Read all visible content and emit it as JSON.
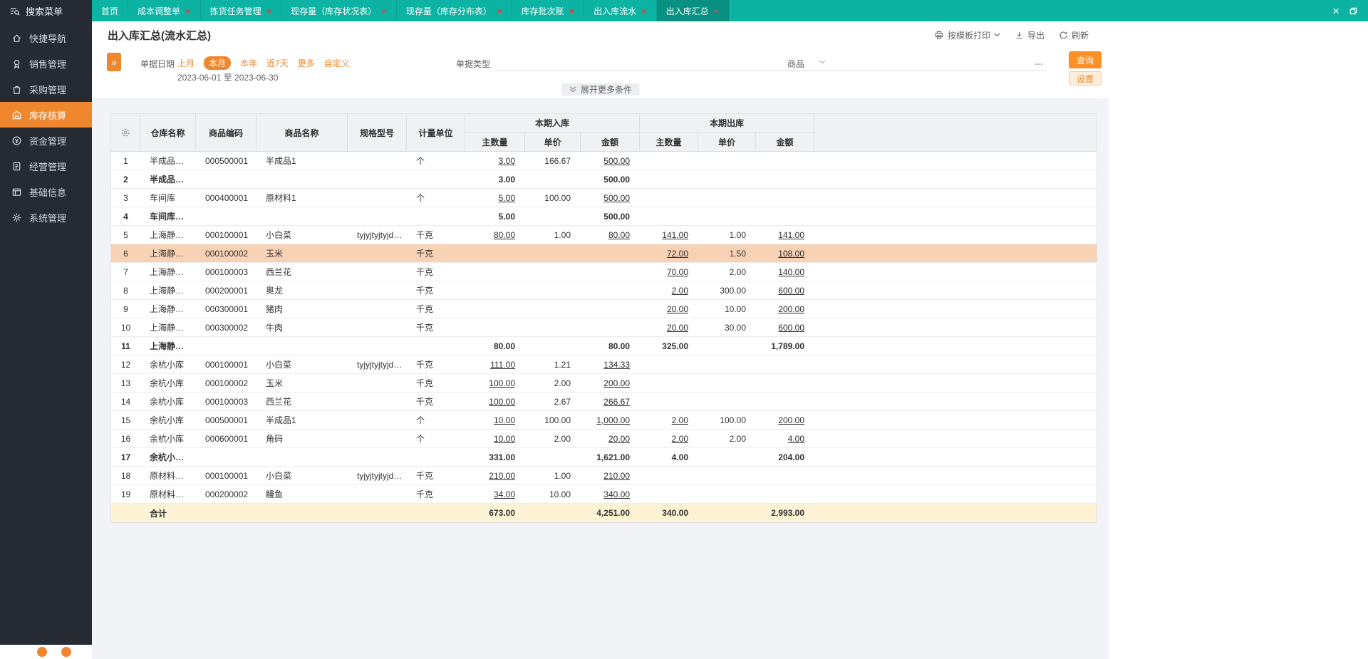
{
  "window": {
    "close_icon_name": "close-icon",
    "restore_icon_name": "restore-icon"
  },
  "sidebar": {
    "search_label": "搜索菜单",
    "search_icon": "search-menu-icon",
    "items": [
      {
        "label": "快捷导航",
        "icon": "nav-icon",
        "active": false
      },
      {
        "label": "销售管理",
        "icon": "sales-icon",
        "active": false
      },
      {
        "label": "采购管理",
        "icon": "purchase-icon",
        "active": false
      },
      {
        "label": "库存核算",
        "icon": "inventory-icon",
        "active": true
      },
      {
        "label": "资金管理",
        "icon": "funds-icon",
        "active": false
      },
      {
        "label": "经营管理",
        "icon": "operation-icon",
        "active": false
      },
      {
        "label": "基础信息",
        "icon": "baseinfo-icon",
        "active": false
      },
      {
        "label": "系统管理",
        "icon": "system-icon",
        "active": false
      }
    ]
  },
  "tabs": [
    {
      "label": "首页",
      "closable": false,
      "active": false
    },
    {
      "label": "成本调整单",
      "closable": true,
      "active": false
    },
    {
      "label": "拣货任务管理",
      "closable": true,
      "active": false
    },
    {
      "label": "现存量（库存状况表）",
      "closable": true,
      "active": false
    },
    {
      "label": "现存量（库存分布表）",
      "closable": true,
      "active": false
    },
    {
      "label": "库存批次账",
      "closable": true,
      "active": false
    },
    {
      "label": "出入库流水",
      "closable": true,
      "active": false
    },
    {
      "label": "出入库汇总",
      "closable": true,
      "active": true
    }
  ],
  "page": {
    "title": "出入库汇总(流水汇总)",
    "print_label": "按模板打印",
    "print_icon": "printer-icon",
    "export_label": "导出",
    "export_icon": "export-icon",
    "refresh_label": "刷新",
    "refresh_icon": "refresh-icon"
  },
  "filters": {
    "expand_collapse_icon": "double-angle-right-icon",
    "date_label": "单据日期",
    "date_options": [
      {
        "label": "上月",
        "selected": false
      },
      {
        "label": "本月",
        "selected": true
      },
      {
        "label": "本年",
        "selected": false
      },
      {
        "label": "近7天",
        "selected": false
      },
      {
        "label": "更多",
        "selected": false
      },
      {
        "label": "自定义",
        "selected": false
      }
    ],
    "date_range": "2023-06-01 至 2023-06-30",
    "doc_type_label": "单据类型",
    "doc_type_value": "",
    "product_label": "商品",
    "product_value": "",
    "product_more": "…",
    "query_button": "查询",
    "settings_button": "设置",
    "expand_more": "展开更多条件"
  },
  "table": {
    "gear_icon": "column-settings-gear-icon",
    "headers": {
      "warehouse": "仓库名称",
      "code": "商品编码",
      "name": "商品名称",
      "spec": "规格型号",
      "unit": "计量单位",
      "in_group": "本期入库",
      "out_group": "本期出库",
      "qty": "主数量",
      "price": "单价",
      "amount": "金额"
    },
    "rows": [
      {
        "idx": "1",
        "warehouse": "半成品仓库",
        "code": "000500001",
        "name": "半成品1",
        "spec": "",
        "unit": "个",
        "in_qty": "3.00",
        "in_price": "166.67",
        "in_amt": "500.00",
        "out_qty": "",
        "out_price": "",
        "out_amt": "",
        "style": "normal"
      },
      {
        "idx": "2",
        "warehouse": "半成品仓库...",
        "code": "",
        "name": "",
        "spec": "",
        "unit": "",
        "in_qty": "3.00",
        "in_price": "",
        "in_amt": "500.00",
        "out_qty": "",
        "out_price": "",
        "out_amt": "",
        "style": "subtotal"
      },
      {
        "idx": "3",
        "warehouse": "车间库",
        "code": "000400001",
        "name": "原材料1",
        "spec": "",
        "unit": "个",
        "in_qty": "5.00",
        "in_price": "100.00",
        "in_amt": "500.00",
        "out_qty": "",
        "out_price": "",
        "out_amt": "",
        "style": "normal"
      },
      {
        "idx": "4",
        "warehouse": "车间库【小...",
        "code": "",
        "name": "",
        "spec": "",
        "unit": "",
        "in_qty": "5.00",
        "in_price": "",
        "in_amt": "500.00",
        "out_qty": "",
        "out_price": "",
        "out_amt": "",
        "style": "subtotal"
      },
      {
        "idx": "5",
        "warehouse": "上海静安仓",
        "code": "000100001",
        "name": "小白菜",
        "spec": "tyjyjtyjtyjdf...",
        "unit": "千克",
        "in_qty": "80.00",
        "in_price": "1.00",
        "in_amt": "80.00",
        "out_qty": "141.00",
        "out_price": "1.00",
        "out_amt": "141.00",
        "style": "normal"
      },
      {
        "idx": "6",
        "warehouse": "上海静安仓",
        "code": "000100002",
        "name": "玉米",
        "spec": "",
        "unit": "千克",
        "in_qty": "",
        "in_price": "",
        "in_amt": "",
        "out_qty": "72.00",
        "out_price": "1.50",
        "out_amt": "108.00",
        "style": "selected"
      },
      {
        "idx": "7",
        "warehouse": "上海静安仓",
        "code": "000100003",
        "name": "西兰花",
        "spec": "",
        "unit": "千克",
        "in_qty": "",
        "in_price": "",
        "in_amt": "",
        "out_qty": "70.00",
        "out_price": "2.00",
        "out_amt": "140.00",
        "style": "normal"
      },
      {
        "idx": "8",
        "warehouse": "上海静安仓",
        "code": "000200001",
        "name": "奥龙",
        "spec": "",
        "unit": "千克",
        "in_qty": "",
        "in_price": "",
        "in_amt": "",
        "out_qty": "2.00",
        "out_price": "300.00",
        "out_amt": "600.00",
        "style": "normal"
      },
      {
        "idx": "9",
        "warehouse": "上海静安仓",
        "code": "000300001",
        "name": "猪肉",
        "spec": "",
        "unit": "千克",
        "in_qty": "",
        "in_price": "",
        "in_amt": "",
        "out_qty": "20.00",
        "out_price": "10.00",
        "out_amt": "200.00",
        "style": "normal"
      },
      {
        "idx": "10",
        "warehouse": "上海静安仓",
        "code": "000300002",
        "name": "牛肉",
        "spec": "",
        "unit": "千克",
        "in_qty": "",
        "in_price": "",
        "in_amt": "",
        "out_qty": "20.00",
        "out_price": "30.00",
        "out_amt": "600.00",
        "style": "normal"
      },
      {
        "idx": "11",
        "warehouse": "上海静安仓...",
        "code": "",
        "name": "",
        "spec": "",
        "unit": "",
        "in_qty": "80.00",
        "in_price": "",
        "in_amt": "80.00",
        "out_qty": "325.00",
        "out_price": "",
        "out_amt": "1,789.00",
        "style": "subtotal"
      },
      {
        "idx": "12",
        "warehouse": "余杭小库",
        "code": "000100001",
        "name": "小白菜",
        "spec": "tyjyjtyjtyjdf...",
        "unit": "千克",
        "in_qty": "111.00",
        "in_price": "1.21",
        "in_amt": "134.33",
        "out_qty": "",
        "out_price": "",
        "out_amt": "",
        "style": "normal"
      },
      {
        "idx": "13",
        "warehouse": "余杭小库",
        "code": "000100002",
        "name": "玉米",
        "spec": "",
        "unit": "千克",
        "in_qty": "100.00",
        "in_price": "2.00",
        "in_amt": "200.00",
        "out_qty": "",
        "out_price": "",
        "out_amt": "",
        "style": "normal"
      },
      {
        "idx": "14",
        "warehouse": "余杭小库",
        "code": "000100003",
        "name": "西兰花",
        "spec": "",
        "unit": "千克",
        "in_qty": "100.00",
        "in_price": "2.67",
        "in_amt": "266.67",
        "out_qty": "",
        "out_price": "",
        "out_amt": "",
        "style": "normal"
      },
      {
        "idx": "15",
        "warehouse": "余杭小库",
        "code": "000500001",
        "name": "半成品1",
        "spec": "",
        "unit": "个",
        "in_qty": "10.00",
        "in_price": "100.00",
        "in_amt": "1,000.00",
        "out_qty": "2.00",
        "out_price": "100.00",
        "out_amt": "200.00",
        "style": "normal"
      },
      {
        "idx": "16",
        "warehouse": "余杭小库",
        "code": "000600001",
        "name": "角码",
        "spec": "",
        "unit": "个",
        "in_qty": "10.00",
        "in_price": "2.00",
        "in_amt": "20.00",
        "out_qty": "2.00",
        "out_price": "2.00",
        "out_amt": "4.00",
        "style": "normal"
      },
      {
        "idx": "17",
        "warehouse": "余杭小库【...",
        "code": "",
        "name": "",
        "spec": "",
        "unit": "",
        "in_qty": "331.00",
        "in_price": "",
        "in_amt": "1,621.00",
        "out_qty": "4.00",
        "out_price": "",
        "out_amt": "204.00",
        "style": "subtotal"
      },
      {
        "idx": "18",
        "warehouse": "原材料仓库",
        "code": "000100001",
        "name": "小白菜",
        "spec": "tyjyjtyjtyjdf...",
        "unit": "千克",
        "in_qty": "210.00",
        "in_price": "1.00",
        "in_amt": "210.00",
        "out_qty": "",
        "out_price": "",
        "out_amt": "",
        "style": "normal"
      },
      {
        "idx": "19",
        "warehouse": "原材料仓库",
        "code": "000200002",
        "name": "鳗鱼",
        "spec": "",
        "unit": "千克",
        "in_qty": "34.00",
        "in_price": "10.00",
        "in_amt": "340.00",
        "out_qty": "",
        "out_price": "",
        "out_amt": "",
        "style": "normal"
      }
    ],
    "total": {
      "label": "合计",
      "in_qty": "673.00",
      "in_amt": "4,251.00",
      "out_qty": "340.00",
      "out_amt": "2,993.00"
    }
  },
  "colors": {
    "accent_orange": "#f0872f",
    "teal_bar": "#0db3a2",
    "active_tab": "#089182",
    "selected_row": "#f8d2b5",
    "total_row": "#fcf3d4",
    "sidebar_bg": "#262a33"
  }
}
